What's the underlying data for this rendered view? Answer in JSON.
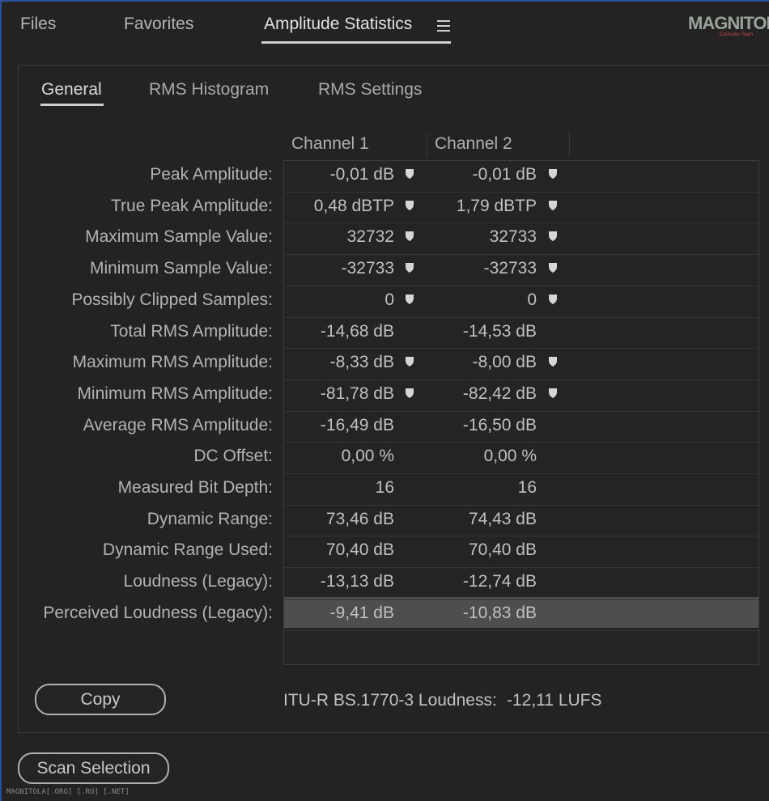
{
  "top_tabs": [
    {
      "label": "Files",
      "active": false
    },
    {
      "label": "Favorites",
      "active": false
    },
    {
      "label": "Amplitude Statistics",
      "active": true
    }
  ],
  "logo": {
    "main": "MAGNITOLA",
    "sub": "CarAudio Team"
  },
  "sub_tabs": [
    {
      "label": "General",
      "active": true
    },
    {
      "label": "RMS Histogram",
      "active": false
    },
    {
      "label": "RMS Settings",
      "active": false
    }
  ],
  "columns": [
    "Channel 1",
    "Channel 2"
  ],
  "rows": [
    {
      "label": "Peak Amplitude:",
      "ch1": "-0,01 dB",
      "ch2": "-0,01 dB",
      "marker": true
    },
    {
      "label": "True Peak Amplitude:",
      "ch1": "0,48 dBTP",
      "ch2": "1,79 dBTP",
      "marker": true
    },
    {
      "label": "Maximum Sample Value:",
      "ch1": "32732",
      "ch2": "32733",
      "marker": true
    },
    {
      "label": "Minimum Sample Value:",
      "ch1": "-32733",
      "ch2": "-32733",
      "marker": true
    },
    {
      "label": "Possibly Clipped Samples:",
      "ch1": "0",
      "ch2": "0",
      "marker": true
    },
    {
      "label": "Total RMS Amplitude:",
      "ch1": "-14,68 dB",
      "ch2": "-14,53 dB",
      "marker": false
    },
    {
      "label": "Maximum RMS Amplitude:",
      "ch1": "-8,33 dB",
      "ch2": "-8,00 dB",
      "marker": true
    },
    {
      "label": "Minimum RMS Amplitude:",
      "ch1": "-81,78 dB",
      "ch2": "-82,42 dB",
      "marker": true
    },
    {
      "label": "Average RMS Amplitude:",
      "ch1": "-16,49 dB",
      "ch2": "-16,50 dB",
      "marker": false
    },
    {
      "label": "DC Offset:",
      "ch1": "0,00 %",
      "ch2": "0,00 %",
      "marker": false
    },
    {
      "label": "Measured Bit Depth:",
      "ch1": "16",
      "ch2": "16",
      "marker": false
    },
    {
      "label": "Dynamic Range:",
      "ch1": "73,46 dB",
      "ch2": "74,43 dB",
      "marker": false
    },
    {
      "label": "Dynamic Range Used:",
      "ch1": "70,40 dB",
      "ch2": "70,40 dB",
      "marker": false
    },
    {
      "label": "Loudness (Legacy):",
      "ch1": "-13,13 dB",
      "ch2": "-12,74 dB",
      "marker": false
    },
    {
      "label": "Perceived Loudness (Legacy):",
      "ch1": "-9,41 dB",
      "ch2": "-10,83 dB",
      "marker": false,
      "selected": true
    }
  ],
  "copy_button": "Copy",
  "loudness": {
    "label": "ITU-R BS.1770-3 Loudness:",
    "value": "-12,11 LUFS"
  },
  "scan_button": "Scan Selection",
  "watermark": "MAGNITOLA[.ORG] [.RU] [.NET]",
  "colors": {
    "background": "#232323",
    "selected_row": "#4e4e4e",
    "text": "#c0c0c0"
  }
}
